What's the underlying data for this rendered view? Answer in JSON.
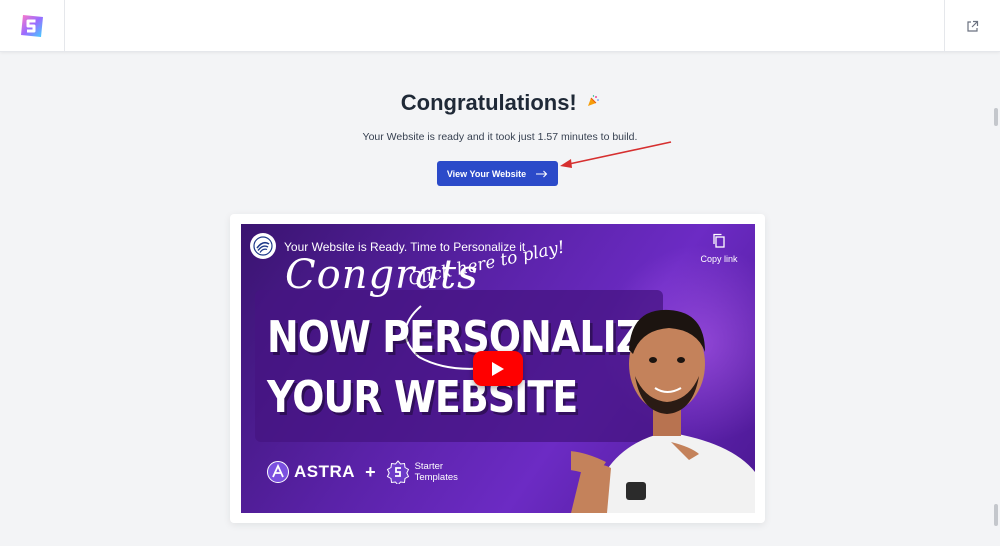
{
  "header": {
    "logo_icon": "starter-templates-logo",
    "external_link_icon": "external-link-icon"
  },
  "main": {
    "title": "Congratulations!",
    "title_icon": "party-popper-icon",
    "subtitle": "Your Website is ready and it took just 1.57 minutes to build.",
    "cta_label": "View Your Website",
    "cta_icon": "arrow-right-icon",
    "cta_color": "#2b4ac9",
    "annotation_color": "#d62f2f"
  },
  "video": {
    "title": "Your Website is Ready. Time to Personalize it",
    "copy_link_label": "Copy link",
    "overlay": {
      "script_text": "Congrats",
      "hint_text": "Click here to play!",
      "headline_line1": "NOW PERSONALIZE",
      "headline_line2": "YOUR WEBSITE",
      "brand1": "ASTRA",
      "plus": "+",
      "brand2_line1": "Starter",
      "brand2_line2": "Templates"
    },
    "play_color": "#ff0000"
  }
}
